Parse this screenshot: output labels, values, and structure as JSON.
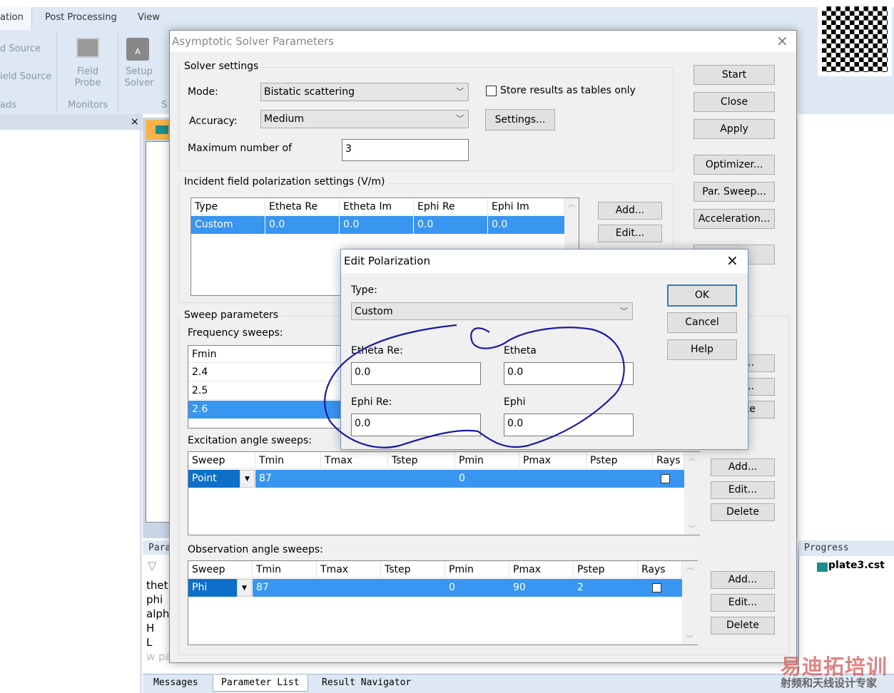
{
  "ribbon": {
    "tabs": [
      "ation",
      "Post Processing",
      "View"
    ],
    "items": [
      "d Source",
      "ield Source",
      "ads"
    ],
    "field_probe": "Field\nProbe",
    "monitors": "Monitors",
    "setup_solver": "Setup\nSolver",
    "sc": "S"
  },
  "left_panel": {
    "close": "×"
  },
  "param_panel": {
    "title": "Para",
    "rows": [
      "thet",
      "phi",
      "alph",
      "H",
      "L"
    ],
    "new": "w pa"
  },
  "progress": {
    "title": "Progress",
    "file": "plate3.cst"
  },
  "bottom_tabs": [
    "Messages",
    "Parameter List",
    "Result Navigator"
  ],
  "solver": {
    "title": "Asymptotic Solver Parameters",
    "close": "×",
    "solver_settings": {
      "label": "Solver settings",
      "mode_label": "Mode:",
      "mode": "Bistatic scattering",
      "accuracy_label": "Accuracy:",
      "accuracy": "Medium",
      "max_label": "Maximum number of",
      "max_value": "3",
      "store_label": "Store results as tables only",
      "store_checked": false,
      "settings_btn": "Settings..."
    },
    "buttons": [
      "Start",
      "Close",
      "Apply",
      "Optimizer...",
      "Par. Sweep...",
      "Acceleration...",
      ""
    ],
    "incident": {
      "label": "Incident field polarization settings (V/m)",
      "headers": [
        "Type",
        "Etheta Re",
        "Etheta Im",
        "Ephi Re",
        "Ephi Im"
      ],
      "rows": [
        [
          "Custom",
          "0.0",
          "0.0",
          "0.0",
          "0.0"
        ]
      ],
      "add": "Add...",
      "edit": "Edit..."
    },
    "sweep": {
      "label": "Sweep parameters",
      "freq_label": "Frequency sweeps:",
      "freq_header": "Fmin",
      "freq_rows": [
        "2.4",
        "2.5",
        "2.6"
      ],
      "freq_selected": 2,
      "freq_buttons": [
        "...",
        "...",
        "te"
      ],
      "exc_label": "Excitation angle sweeps:",
      "exc_headers": [
        "Sweep",
        "Tmin",
        "Tmax",
        "Tstep",
        "Pmin",
        "Pmax",
        "Pstep",
        "Rays"
      ],
      "exc_row": [
        "Point",
        "87",
        "",
        "",
        "0",
        "",
        "",
        ""
      ],
      "exc_rays": true,
      "obs_label": "Observation angle sweeps:",
      "obs_headers": [
        "Sweep",
        "Tmin",
        "Tmax",
        "Tstep",
        "Pmin",
        "Pmax",
        "Pstep",
        "Rays"
      ],
      "obs_row": [
        "Phi",
        "87",
        "",
        "",
        "0",
        "90",
        "2",
        ""
      ],
      "obs_rays": false,
      "add": "Add...",
      "edit": "Edit...",
      "delete": "Delete"
    }
  },
  "edit_pol": {
    "title": "Edit Polarization",
    "close": "×",
    "type_label": "Type:",
    "type": "Custom",
    "etheta_re_label": "Etheta Re:",
    "etheta_re": "0.0",
    "etheta_label": "Etheta",
    "etheta": "0.0",
    "ephi_re_label": "Ephi Re:",
    "ephi_re": "0.0",
    "ephi_label": "Ephi",
    "ephi": "0.0",
    "ok": "OK",
    "cancel": "Cancel",
    "help": "Help"
  },
  "watermark": {
    "line1": "易迪拓培训",
    "line2": "射频和天线设计专家"
  },
  "colors": {
    "selection": "#3895f0",
    "annotation": "#1a1aa8",
    "ribbon": "#dde8f4"
  }
}
